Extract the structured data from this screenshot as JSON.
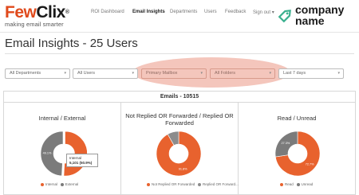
{
  "brand": {
    "few": "Few",
    "clix": "Clix",
    "reg": "®",
    "tagline": "making email smarter",
    "company_name_line1": "company",
    "company_name_line2": "name"
  },
  "nav": {
    "items": [
      "ROI Dashboard",
      "Email Insights",
      "Departments",
      "Users",
      "Feedback"
    ],
    "sign_out": "Sign out",
    "active": "Email Insights"
  },
  "page": {
    "title": "Email Insights - 25 Users"
  },
  "filters": {
    "department": "All Departments",
    "users": "All Users",
    "mailbox": "Primary Mailbox",
    "folders": "All Folders",
    "range": "Last 7 days"
  },
  "panel": {
    "header": "Emails - 10515"
  },
  "charts": {
    "internal_external": {
      "title": "Internal / External",
      "legend": [
        "Internal",
        "External"
      ],
      "tooltip_title": "Internal",
      "tooltip_value": "5,101 (50.9%)",
      "label_grey": "49.1%",
      "colors": {
        "internal": "#e8622e",
        "external": "#7b7b7b"
      }
    },
    "replied": {
      "title": "Not Replied OR Forwarded / Replied OR Forwarded",
      "legend": [
        "Not Replied OR Forwarded",
        "Replied OR Forward..."
      ],
      "label_main": "91.8%",
      "colors": {
        "not_replied": "#e8622e",
        "replied": "#8c8c8c"
      }
    },
    "read_unread": {
      "title": "Read / Unread",
      "legend": [
        "Read",
        "Unread"
      ],
      "label_read": "72.7%",
      "label_unread": "27.3%",
      "colors": {
        "read": "#e8622e",
        "unread": "#7b7b7b"
      }
    }
  },
  "chart_data": [
    {
      "type": "pie",
      "title": "Internal / External",
      "categories": [
        "Internal",
        "External"
      ],
      "values": [
        50.9,
        49.1
      ]
    },
    {
      "type": "pie",
      "title": "Not Replied OR Forwarded / Replied OR Forwarded",
      "categories": [
        "Not Replied OR Forwarded",
        "Replied OR Forward..."
      ],
      "values": [
        91.8,
        8.2
      ]
    },
    {
      "type": "pie",
      "title": "Read / Unread",
      "categories": [
        "Read",
        "Unread"
      ],
      "values": [
        72.7,
        27.3
      ]
    }
  ]
}
